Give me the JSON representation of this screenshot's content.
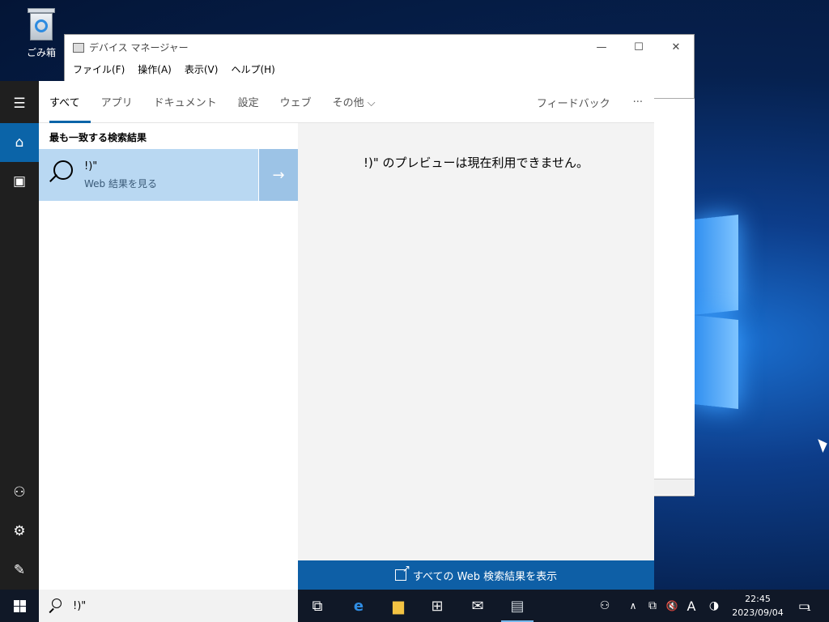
{
  "desktop": {
    "recycle_bin_label": "ごみ箱"
  },
  "device_manager": {
    "title": "デバイス マネージャー",
    "menu": [
      "ファイル(F)",
      "操作(A)",
      "表示(V)",
      "ヘルプ(H)"
    ],
    "minimize": "—",
    "maximize": "☐",
    "close": "✕"
  },
  "rail": {
    "menu_icon": "hamburger-icon",
    "home_icon": "home-icon",
    "docs_icon": "notebook-icon",
    "user_icon": "add-user-icon",
    "settings_icon": "gear-icon",
    "feedback_icon": "feedback-icon"
  },
  "search": {
    "tabs": [
      "すべて",
      "アプリ",
      "ドキュメント",
      "設定",
      "ウェブ",
      "その他 ⌵"
    ],
    "feedback": "フィードバック",
    "more": "···",
    "best_match_title": "最も一致する検索結果",
    "best_match": {
      "query": "!)\"",
      "subtitle": "Web 結果を見る",
      "arrow": "→"
    },
    "preview_message": "!)\" のプレビューは現在利用できません。",
    "see_all_web": "すべての Web 検索結果を表示",
    "input_value": "!)\""
  },
  "taskbar": {
    "apps": [
      "task-view-icon",
      "edge-icon",
      "file-explorer-icon",
      "store-icon",
      "mail-icon",
      "device-manager-icon"
    ],
    "tray": {
      "people": "⚇",
      "chevron": "∧",
      "network": "⧉",
      "volume": "🔇",
      "ime": "A",
      "battery": "◑"
    },
    "time": "22:45",
    "date": "2023/09/04",
    "notification_count": "1"
  },
  "colors": {
    "accent": "#0b64a8",
    "best_match_bg": "#b9d8f2",
    "web_button": "#0e5fa6"
  }
}
